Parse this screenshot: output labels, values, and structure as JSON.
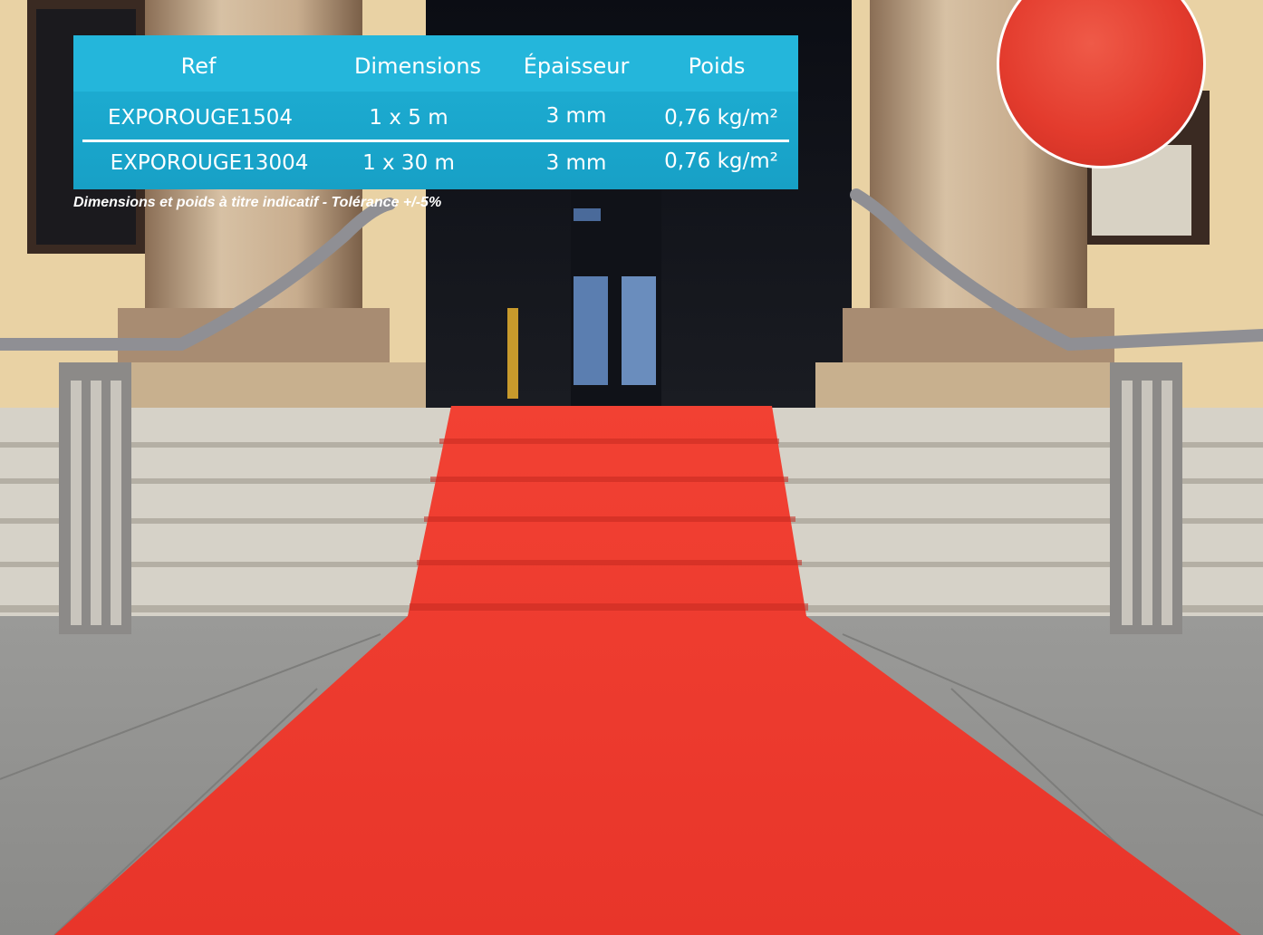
{
  "table": {
    "headers": [
      "Ref",
      "Dimensions",
      "Épaisseur",
      "Poids"
    ],
    "rows": [
      {
        "ref": "EXPOROUGE1504",
        "dimensions": "1 x 5 m",
        "thickness": "3 mm",
        "weight": "0,76 kg/m²"
      },
      {
        "ref": "EXPOROUGE13004",
        "dimensions": "1 x 30 m",
        "thickness": "3 mm",
        "weight": "0,76 kg/m²"
      }
    ]
  },
  "note": "Dimensions et poids à titre indicatif - Tolérance +/-5%",
  "colors": {
    "accent": "#1fb1d6",
    "carpet": "#e8352a"
  }
}
